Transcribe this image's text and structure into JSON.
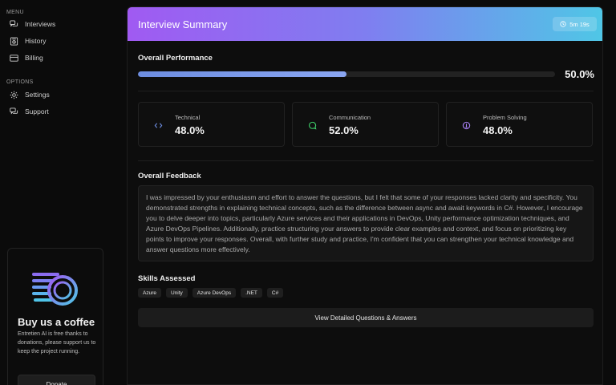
{
  "sidebar": {
    "menu_title": "MENU",
    "menu_items": [
      {
        "label": "Interviews",
        "icon": "chat-bubbles-icon"
      },
      {
        "label": "History",
        "icon": "history-icon"
      },
      {
        "label": "Billing",
        "icon": "credit-card-icon"
      }
    ],
    "options_title": "OPTIONS",
    "option_items": [
      {
        "label": "Settings",
        "icon": "gear-icon"
      },
      {
        "label": "Support",
        "icon": "support-chat-icon"
      }
    ],
    "coffee": {
      "title": "Buy us a coffee",
      "text": "Entretien AI is free thanks to donations, please support us to keep the project running.",
      "donate_label": "Donate"
    }
  },
  "header": {
    "title": "Interview Summary",
    "timer": "5m 19s",
    "gradient": [
      "#a05af2",
      "#7f7ef0",
      "#4fc7e6"
    ]
  },
  "overall": {
    "title": "Overall Performance",
    "value_text": "50.0%",
    "value": 50.0
  },
  "metrics": [
    {
      "label": "Technical",
      "value": "48.0%",
      "icon": "code-icon",
      "color": "#6d8de0"
    },
    {
      "label": "Communication",
      "value": "52.0%",
      "icon": "message-icon",
      "color": "#3ecf6a"
    },
    {
      "label": "Problem Solving",
      "value": "48.0%",
      "icon": "lightbulb-icon",
      "color": "#a67ff2"
    }
  ],
  "feedback": {
    "title": "Overall Feedback",
    "text": "I was impressed by your enthusiasm and effort to answer the questions, but I felt that some of your responses lacked clarity and specificity. You demonstrated strengths in explaining technical concepts, such as the difference between async and await keywords in C#. However, I encourage you to delve deeper into topics, particularly Azure services and their applications in DevOps, Unity performance optimization techniques, and Azure DevOps Pipelines. Additionally, practice structuring your answers to provide clear examples and context, and focus on prioritizing key points to improve your responses. Overall, with further study and practice, I'm confident that you can strengthen your technical knowledge and answer questions more effectively."
  },
  "skills": {
    "title": "Skills Assessed",
    "items": [
      "Azure",
      "Unity",
      "Azure DevOps",
      ".NET",
      "C#"
    ]
  },
  "actions": {
    "view_details_label": "View Detailed Questions & Answers"
  }
}
